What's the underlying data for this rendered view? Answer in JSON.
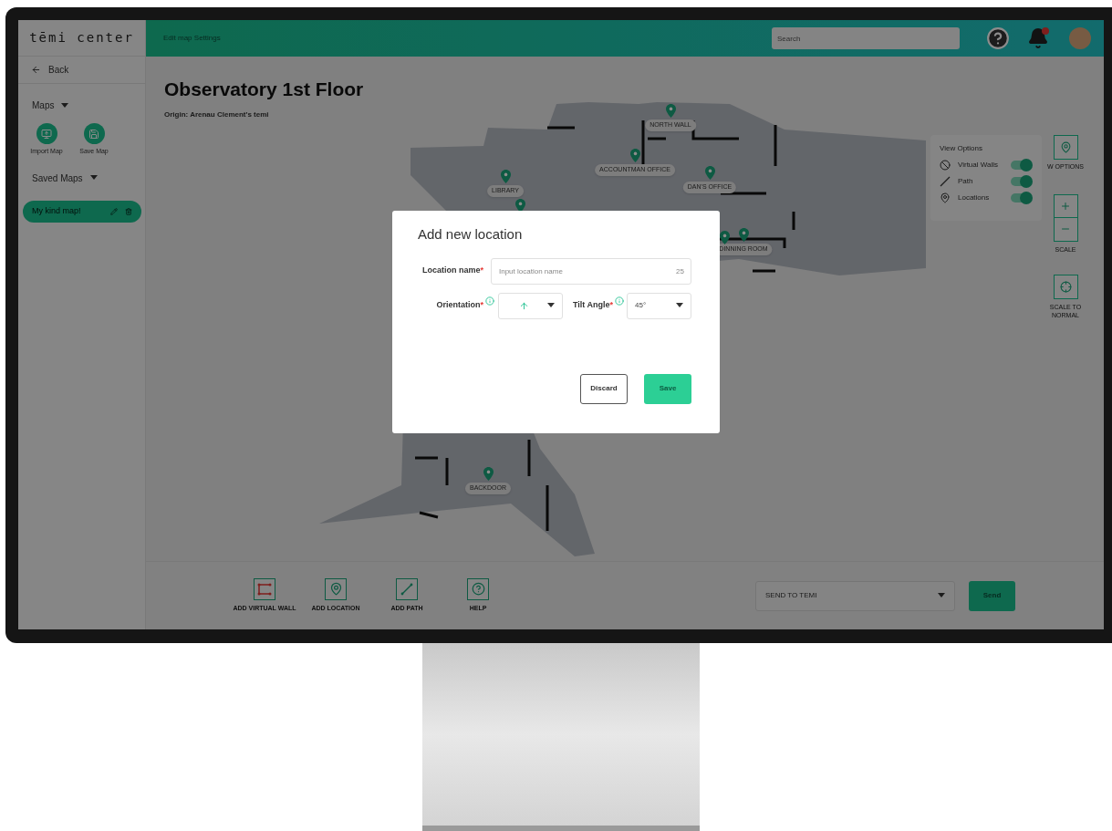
{
  "logo": "tēmi center",
  "header": {
    "title": "Edit map Settings",
    "search": {
      "placeholder": "Search"
    },
    "notification": true
  },
  "sidebar": {
    "back": "Back",
    "maps": {
      "label": "Maps",
      "expanded": true,
      "actions": [
        {
          "kind": "import",
          "label": "Import Map"
        },
        {
          "kind": "save",
          "label": "Save Map"
        }
      ]
    },
    "saved_maps": {
      "label": "Saved Maps",
      "expanded": true,
      "items": [
        {
          "label": "My kind map!",
          "selected": true
        }
      ]
    }
  },
  "map": {
    "title": "Observatory 1st Floor",
    "origin": "Origin: Arenau Clement's temi",
    "locations": [
      {
        "label": "NORTH WALL"
      },
      {
        "label": "ACCOUNTMAN OFFICE"
      },
      {
        "label": "DAN'S OFFICE"
      },
      {
        "label": "LIBRARY"
      },
      {
        "label": "DINNING ROOM"
      },
      {
        "label": "BACKDOOR"
      }
    ]
  },
  "view_options": {
    "title": "View Options",
    "items": [
      {
        "kind": "virtual_walls",
        "label": "Virtual Walls",
        "on": true
      },
      {
        "kind": "path",
        "label": "Path",
        "on": true
      },
      {
        "kind": "locations",
        "label": "Locations",
        "on": true
      }
    ]
  },
  "map_controls": {
    "view_options_label": "W OPTIONS",
    "scale_label": "SCALE",
    "scale_normal_label": "SCALE TO NORMAL"
  },
  "toolbar": {
    "tools": [
      {
        "kind": "virtual_wall",
        "label": "ADD VIRTUAL WALL"
      },
      {
        "kind": "location",
        "label": "ADD LOCATION"
      },
      {
        "kind": "path",
        "label": "ADD PATH"
      },
      {
        "kind": "help",
        "label": "HELP"
      }
    ],
    "send_target": "SEND TO TEMI",
    "send": "Send"
  },
  "dialog": {
    "title": "Add new location",
    "name": {
      "label": "Location name",
      "required_mark": "*",
      "placeholder": "Input location name",
      "counter": "25"
    },
    "orientation": {
      "label": "Orientation",
      "required_mark": "*"
    },
    "tilt": {
      "label": "Tilt Angle",
      "required_mark": "*",
      "value": "45°"
    },
    "discard": "Discard",
    "save": "Save"
  }
}
